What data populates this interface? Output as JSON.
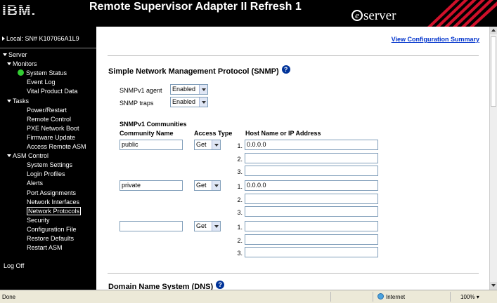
{
  "header": {
    "logo": "IBM.",
    "title": "Remote Supervisor Adapter II Refresh 1",
    "brand": "server",
    "brand_e": "e"
  },
  "sidebar": {
    "local": "Local:  SN# K107066A1L9",
    "items": [
      {
        "label": "Server",
        "level": 0,
        "kind": "section"
      },
      {
        "label": "Monitors",
        "level": 1,
        "kind": "section"
      },
      {
        "label": "System Status",
        "level": 2,
        "kind": "status"
      },
      {
        "label": "Event Log",
        "level": 2
      },
      {
        "label": "Vital Product Data",
        "level": 2
      },
      {
        "label": "Tasks",
        "level": 1,
        "kind": "section"
      },
      {
        "label": "Power/Restart",
        "level": 2
      },
      {
        "label": "Remote Control",
        "level": 2
      },
      {
        "label": "PXE Network Boot",
        "level": 2
      },
      {
        "label": "Firmware Update",
        "level": 2
      },
      {
        "label": "Access Remote ASM",
        "level": 2
      },
      {
        "label": "ASM Control",
        "level": 1,
        "kind": "section"
      },
      {
        "label": "System Settings",
        "level": 2
      },
      {
        "label": "Login Profiles",
        "level": 2
      },
      {
        "label": "Alerts",
        "level": 2
      },
      {
        "label": "Port Assignments",
        "level": 2
      },
      {
        "label": "Network Interfaces",
        "level": 2
      },
      {
        "label": "Network Protocols",
        "level": 2,
        "active": true
      },
      {
        "label": "Security",
        "level": 2
      },
      {
        "label": "Configuration File",
        "level": 2
      },
      {
        "label": "Restore Defaults",
        "level": 2
      },
      {
        "label": "Restart ASM",
        "level": 2
      }
    ],
    "logoff": "Log Off"
  },
  "content": {
    "view_config": "View Configuration Summary",
    "snmp_title": "Simple Network Management Protocol (SNMP)",
    "snmpv1_agent_label": "SNMPv1 agent",
    "snmpv1_agent_value": "Enabled",
    "snmp_traps_label": "SNMP traps",
    "snmp_traps_value": "Enabled",
    "communities_title": "SNMPv1 Communities",
    "col_name": "Community Name",
    "col_access": "Access Type",
    "col_host": "Host Name or IP Address",
    "communities": [
      {
        "name": "public",
        "access": "Get",
        "hosts": [
          "0.0.0.0",
          "",
          ""
        ]
      },
      {
        "name": "private",
        "access": "Get",
        "hosts": [
          "0.0.0.0",
          "",
          ""
        ]
      },
      {
        "name": "",
        "access": "Get",
        "hosts": [
          "",
          "",
          ""
        ]
      }
    ],
    "host_numbers": [
      "1.",
      "2.",
      "3."
    ],
    "dns_title": "Domain Name System (DNS)",
    "help_glyph": "?"
  },
  "statusbar": {
    "done": "Done",
    "zone": "Internet",
    "zoom": "100%"
  }
}
